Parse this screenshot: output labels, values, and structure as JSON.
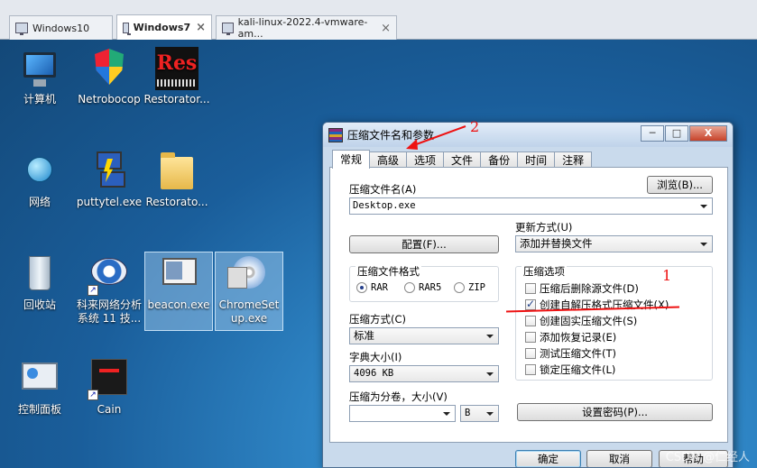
{
  "vm_tabs": [
    {
      "label": "Windows10",
      "active": false
    },
    {
      "label": "Windows7",
      "active": true
    },
    {
      "label": "kali-linux-2022.4-vmware-am...",
      "active": false
    }
  ],
  "desktop_icons": [
    {
      "label": "计算机",
      "icon": "computer-icon"
    },
    {
      "label": "Netrobocop",
      "icon": "shield-icon"
    },
    {
      "label": "Restorator...",
      "icon": "restorator-icon"
    },
    {
      "label": "网络",
      "icon": "network-icon"
    },
    {
      "label": "puttytel.exe",
      "icon": "putty-icon"
    },
    {
      "label": "Restorato...",
      "icon": "folder-icon"
    },
    {
      "label": "回收站",
      "icon": "recycle-bin-icon"
    },
    {
      "label": "科来网络分析系统 11 技...",
      "icon": "network-analyzer-icon"
    },
    {
      "label": "beacon.exe",
      "icon": "exe-icon"
    },
    {
      "label": "ChromeSetup.exe",
      "icon": "installer-icon"
    },
    {
      "label": "控制面板",
      "icon": "control-panel-icon"
    },
    {
      "label": "Cain",
      "icon": "cain-icon"
    }
  ],
  "dialog": {
    "title": "压缩文件名和参数",
    "min": "─",
    "max": "□",
    "close": "X",
    "tabs": [
      "常规",
      "高级",
      "选项",
      "文件",
      "备份",
      "时间",
      "注释"
    ],
    "archive_name_label": "压缩文件名(A)",
    "browse_button": "浏览(B)...",
    "archive_name_value": "Desktop.exe",
    "update_mode_label": "更新方式(U)",
    "update_mode_value": "添加并替换文件",
    "profiles_button": "配置(F)...",
    "format_group_label": "压缩文件格式",
    "formats": [
      {
        "label": "RAR",
        "selected": true
      },
      {
        "label": "RAR5",
        "selected": false
      },
      {
        "label": "ZIP",
        "selected": false
      }
    ],
    "options_group_label": "压缩选项",
    "options": [
      {
        "label": "压缩后删除源文件(D)",
        "checked": false
      },
      {
        "label": "创建自解压格式压缩文件(X)",
        "checked": true
      },
      {
        "label": "创建固实压缩文件(S)",
        "checked": false
      },
      {
        "label": "添加恢复记录(E)",
        "checked": false
      },
      {
        "label": "测试压缩文件(T)",
        "checked": false
      },
      {
        "label": "锁定压缩文件(L)",
        "checked": false
      }
    ],
    "method_label": "压缩方式(C)",
    "method_value": "标准",
    "dict_label": "字典大小(I)",
    "dict_value": "4096 KB",
    "split_label": "压缩为分卷，大小(V)",
    "split_value": "",
    "split_unit": "B",
    "password_button": "设置密码(P)...",
    "ok_button": "确定",
    "cancel_button": "取消",
    "help_button": "帮助"
  },
  "annotations": {
    "one": "1",
    "two": "2"
  },
  "watermark": "CSDN @仁经人"
}
